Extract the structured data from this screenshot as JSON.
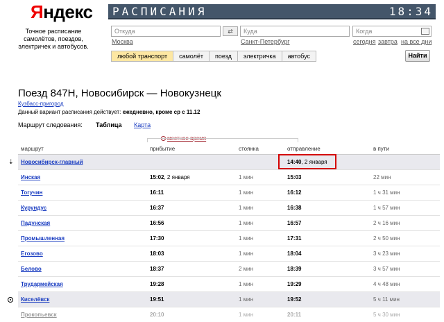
{
  "brand": {
    "logo_first": "Я",
    "logo_rest": "ндекс",
    "tagline": "Точное расписание самолётов, поездов, электричек и автобусов."
  },
  "banner": {
    "title": "РАСПИСАНИЯ",
    "clock": "18:34"
  },
  "search": {
    "from_placeholder": "Откуда",
    "from_hint": "Москва",
    "to_placeholder": "Куда",
    "to_hint": "Санкт-Петербург",
    "when_placeholder": "Когда",
    "when_hints": [
      "сегодня",
      "завтра",
      "на все дни"
    ],
    "swap_label": "⇄",
    "find_label": "Найти"
  },
  "transport_tabs": [
    {
      "label": "любой транспорт",
      "active": true
    },
    {
      "label": "самолёт",
      "active": false
    },
    {
      "label": "поезд",
      "active": false
    },
    {
      "label": "электричка",
      "active": false
    },
    {
      "label": "автобус",
      "active": false
    }
  ],
  "trip": {
    "title": "Поезд 847Н, Новосибирск — Новокузнецк",
    "region": "Кузбасс-пригород",
    "validity_prefix": "Данный вариант расписания действует:",
    "validity_value": "ежедневно, кроме ср с 11.12",
    "route_label": "Маршрут следования:",
    "view_table": "Таблица",
    "view_map": "Карта",
    "local_time": "местное время"
  },
  "columns": [
    "маршрут",
    "прибытие",
    "стоянка",
    "отправление",
    "в пути"
  ],
  "rows": [
    {
      "station": "Новосибирск-главный",
      "arr": "",
      "arr_date": "",
      "stop": "",
      "dep": "14:40",
      "dep_date": ", 2 января",
      "dur": "",
      "hl": true,
      "marker": "arrow",
      "boxed": true
    },
    {
      "station": "Инская",
      "arr": "15:02",
      "arr_date": ", 2 января",
      "stop": "1 мин",
      "dep": "15:03",
      "dep_date": "",
      "dur": "22 мин"
    },
    {
      "station": "Тогучин",
      "arr": "16:11",
      "arr_date": "",
      "stop": "1 мин",
      "dep": "16:12",
      "dep_date": "",
      "dur": "1 ч 31 мин"
    },
    {
      "station": "Курундус",
      "arr": "16:37",
      "arr_date": "",
      "stop": "1 мин",
      "dep": "16:38",
      "dep_date": "",
      "dur": "1 ч 57 мин"
    },
    {
      "station": "Падунская",
      "arr": "16:56",
      "arr_date": "",
      "stop": "1 мин",
      "dep": "16:57",
      "dep_date": "",
      "dur": "2 ч 16 мин"
    },
    {
      "station": "Промышленная",
      "arr": "17:30",
      "arr_date": "",
      "stop": "1 мин",
      "dep": "17:31",
      "dep_date": "",
      "dur": "2 ч 50 мин"
    },
    {
      "station": "Егозово",
      "arr": "18:03",
      "arr_date": "",
      "stop": "1 мин",
      "dep": "18:04",
      "dep_date": "",
      "dur": "3 ч 23 мин"
    },
    {
      "station": "Белово",
      "arr": "18:37",
      "arr_date": "",
      "stop": "2 мин",
      "dep": "18:39",
      "dep_date": "",
      "dur": "3 ч 57 мин"
    },
    {
      "station": "Трудармейская",
      "arr": "19:28",
      "arr_date": "",
      "stop": "1 мин",
      "dep": "19:29",
      "dep_date": "",
      "dur": "4 ч 48 мин"
    },
    {
      "station": "Киселёвск",
      "arr": "19:51",
      "arr_date": "",
      "stop": "1 мин",
      "dep": "19:52",
      "dep_date": "",
      "dur": "5 ч 11 мин",
      "hl": true,
      "marker": "dot"
    },
    {
      "station": "Прокопьевск",
      "arr": "20:10",
      "arr_date": "",
      "stop": "1 мин",
      "dep": "20:11",
      "dep_date": "",
      "dur": "5 ч 30 мин",
      "faded": true
    }
  ]
}
